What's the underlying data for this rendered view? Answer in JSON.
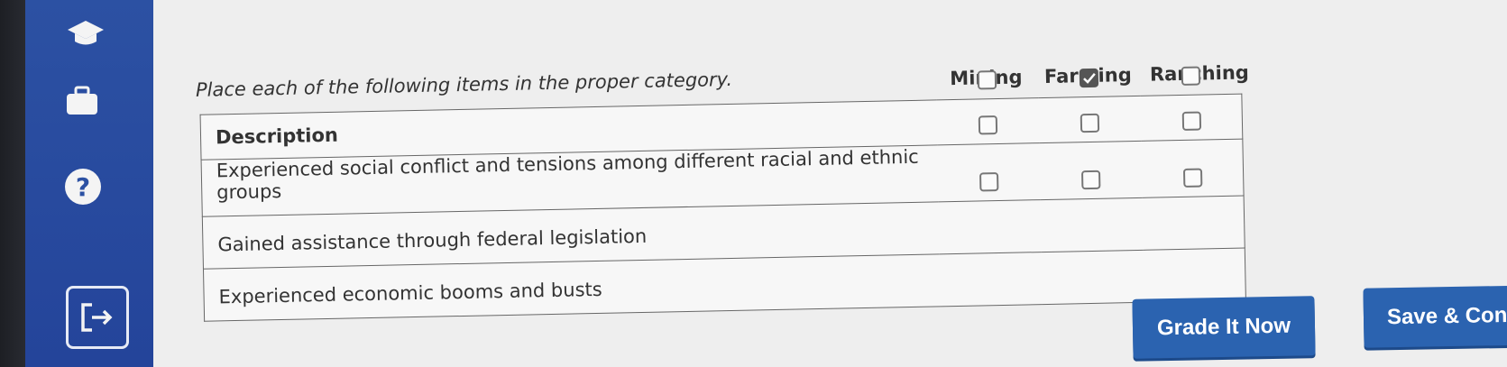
{
  "sidebar": {
    "items": [
      {
        "icon": "graduation-cap-icon"
      },
      {
        "icon": "briefcase-icon"
      },
      {
        "icon": "help-icon",
        "glyph": "?"
      },
      {
        "icon": "exit-icon"
      }
    ]
  },
  "question": {
    "prompt": "Place each of the following items in the proper category.",
    "columns": [
      "Mining",
      "Farming",
      "Ranching"
    ],
    "description_header": "Description",
    "rows": [
      {
        "text": "Experienced social conflict and tensions among different racial and ethnic groups",
        "checked": [
          false,
          true,
          false
        ]
      },
      {
        "text": "Gained assistance through federal legislation",
        "checked": [
          false,
          false,
          false
        ]
      },
      {
        "text": "Experienced economic booms and busts",
        "checked": [
          false,
          false,
          false
        ]
      }
    ]
  },
  "actions": {
    "grade_label": "Grade It Now",
    "save_label": "Save & Con"
  },
  "colors": {
    "sidebar": "#2c51a3",
    "button": "#2b63b0"
  }
}
